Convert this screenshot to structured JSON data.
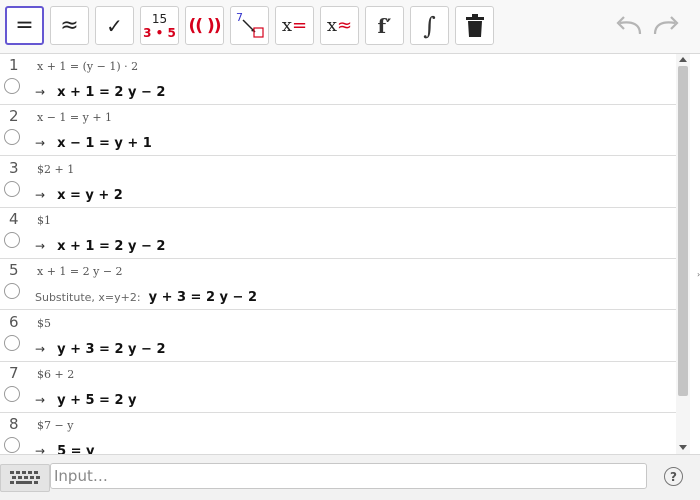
{
  "toolbar": {
    "tools": [
      {
        "id": "evaluate",
        "glyph": "="
      },
      {
        "id": "numeric",
        "glyph": "≈"
      },
      {
        "id": "check",
        "glyph": "✓"
      },
      {
        "id": "factor-numbers",
        "top": "15",
        "bottom": "3 • 5"
      },
      {
        "id": "expand",
        "glyph": "(( ))"
      },
      {
        "id": "substitute",
        "glyph": "7"
      },
      {
        "id": "solve",
        "glyph": "x=",
        "main": "x",
        "suffix": "="
      },
      {
        "id": "solve-numeric",
        "glyph": "x≈",
        "main": "x",
        "suffix": "≈"
      },
      {
        "id": "derivative",
        "glyph": "f′"
      },
      {
        "id": "integral",
        "glyph": "∫"
      },
      {
        "id": "delete",
        "icon": "trash-icon"
      }
    ],
    "undo_icon": "undo-icon",
    "redo_icon": "redo-icon"
  },
  "rows": [
    {
      "num": "1",
      "input": "x + 1 = (y − 1) · 2",
      "arrow": "→",
      "note": "",
      "result": "x + 1 = 2 y − 2"
    },
    {
      "num": "2",
      "input": "x − 1 = y + 1",
      "arrow": "→",
      "note": "",
      "result": "x − 1 = y + 1"
    },
    {
      "num": "3",
      "input": "$2 + 1",
      "arrow": "→",
      "note": "",
      "result": "x = y + 2"
    },
    {
      "num": "4",
      "input": "$1",
      "arrow": "→",
      "note": "",
      "result": "x + 1 = 2 y − 2"
    },
    {
      "num": "5",
      "input": "x + 1 = 2 y − 2",
      "arrow": "",
      "note": "Substitute, x=y+2:",
      "result": "y + 3 = 2 y − 2"
    },
    {
      "num": "6",
      "input": "$5",
      "arrow": "→",
      "note": "",
      "result": "y + 3 = 2 y − 2"
    },
    {
      "num": "7",
      "input": "$6 + 2",
      "arrow": "→",
      "note": "",
      "result": "y + 5 = 2 y"
    },
    {
      "num": "8",
      "input": "$7 − y",
      "arrow": "→",
      "note": "",
      "result": "5 = y"
    }
  ],
  "input_bar": {
    "placeholder": "Input…",
    "keyboard_icon": "keyboard-icon",
    "help_label": "?"
  },
  "colors": {
    "accent": "#6557d2",
    "red": "#d6001c"
  }
}
